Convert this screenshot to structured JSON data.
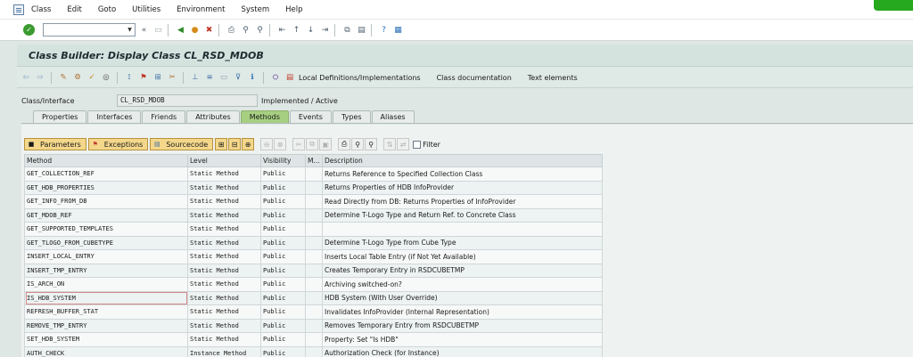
{
  "menubar": {
    "items": [
      {
        "label": "Class"
      },
      {
        "label": "Edit"
      },
      {
        "label": "Goto"
      },
      {
        "label": "Utilities"
      },
      {
        "label": "Environment"
      },
      {
        "label": "System"
      },
      {
        "label": "Help"
      }
    ]
  },
  "systoolbar": {
    "command_value": "",
    "icons": [
      "enter-icon",
      "save-icon",
      "back-icon",
      "exit-icon",
      "cancel-icon",
      "print-icon",
      "find-icon",
      "find-next-icon",
      "first-page-icon",
      "previous-page-icon",
      "next-page-icon",
      "last-page-icon",
      "new-session-icon",
      "shortcut-icon",
      "help-icon",
      "customize-layout-icon"
    ]
  },
  "title": "Class Builder: Display Class CL_RSD_MDOB",
  "apptoolbar": {
    "local_defs_label": "Local Definitions/Implementations",
    "class_doc_label": "Class documentation",
    "text_elements_label": "Text elements"
  },
  "header": {
    "class_label": "Class/Interface",
    "class_value": "CL_RSD_MDOB",
    "status": "Implemented / Active"
  },
  "tabs": [
    "Properties",
    "Interfaces",
    "Friends",
    "Attributes",
    "Methods",
    "Events",
    "Types",
    "Aliases"
  ],
  "active_tab": "Methods",
  "methods_toolbar": {
    "parameters_label": "Parameters",
    "exceptions_label": "Exceptions",
    "sourcecode_label": "Sourcecode",
    "filter_label": "Filter"
  },
  "grid": {
    "columns": [
      "Method",
      "Level",
      "Visibility",
      "M...",
      "Description"
    ],
    "rows": [
      {
        "method": "GET_COLLECTION_REF",
        "level": "Static Method",
        "visibility": "Public",
        "m": "",
        "description": "Returns Reference to Specified Collection Class"
      },
      {
        "method": "GET_HDB_PROPERTIES",
        "level": "Static Method",
        "visibility": "Public",
        "m": "",
        "description": "Returns Properties of HDB InfoProvider"
      },
      {
        "method": "GET_INFO_FROM_DB",
        "level": "Static Method",
        "visibility": "Public",
        "m": "",
        "description": "Read Directly from DB: Returns Properties of InfoProvider"
      },
      {
        "method": "GET_MDOB_REF",
        "level": "Static Method",
        "visibility": "Public",
        "m": "",
        "description": "Determine T-Logo Type and Return Ref. to Concrete Class"
      },
      {
        "method": "GET_SUPPORTED_TEMPLATES",
        "level": "Static Method",
        "visibility": "Public",
        "m": "",
        "description": ""
      },
      {
        "method": "GET_TLOGO_FROM_CUBETYPE",
        "level": "Static Method",
        "visibility": "Public",
        "m": "",
        "description": "Determine T-Logo Type from Cube Type"
      },
      {
        "method": "INSERT_LOCAL_ENTRY",
        "level": "Static Method",
        "visibility": "Public",
        "m": "",
        "description": "Inserts Local Table Entry (if Not Yet Available)"
      },
      {
        "method": "INSERT_TMP_ENTRY",
        "level": "Static Method",
        "visibility": "Public",
        "m": "",
        "description": "Creates Temporary Entry in RSDCUBETMP"
      },
      {
        "method": "IS_ARCH_ON",
        "level": "Static Method",
        "visibility": "Public",
        "m": "",
        "description": "Archiving switched-on?"
      },
      {
        "method": "IS_HDB_SYSTEM",
        "level": "Static Method",
        "visibility": "Public",
        "m": "",
        "description": "HDB System (With User Override)"
      },
      {
        "method": "REFRESH_BUFFER_STAT",
        "level": "Static Method",
        "visibility": "Public",
        "m": "",
        "description": "Invalidates InfoProvider (Internal Representation)"
      },
      {
        "method": "REMOVE_TMP_ENTRY",
        "level": "Static Method",
        "visibility": "Public",
        "m": "",
        "description": "Removes Temporary Entry from RSDCUBETMP"
      },
      {
        "method": "SET_HDB_SYSTEM",
        "level": "Static Method",
        "visibility": "Public",
        "m": "",
        "description": "Property: Set \"Is HDB\""
      },
      {
        "method": "AUTH_CHECK",
        "level": "Instance Method",
        "visibility": "Public",
        "m": "",
        "description": "Authorization Check (for Instance)"
      }
    ]
  },
  "colors": {
    "title_bg": "#d5e3df",
    "active_tab": "#a7cf82",
    "button_yellow": "#f4d78b",
    "status_green": "#26a81f"
  }
}
